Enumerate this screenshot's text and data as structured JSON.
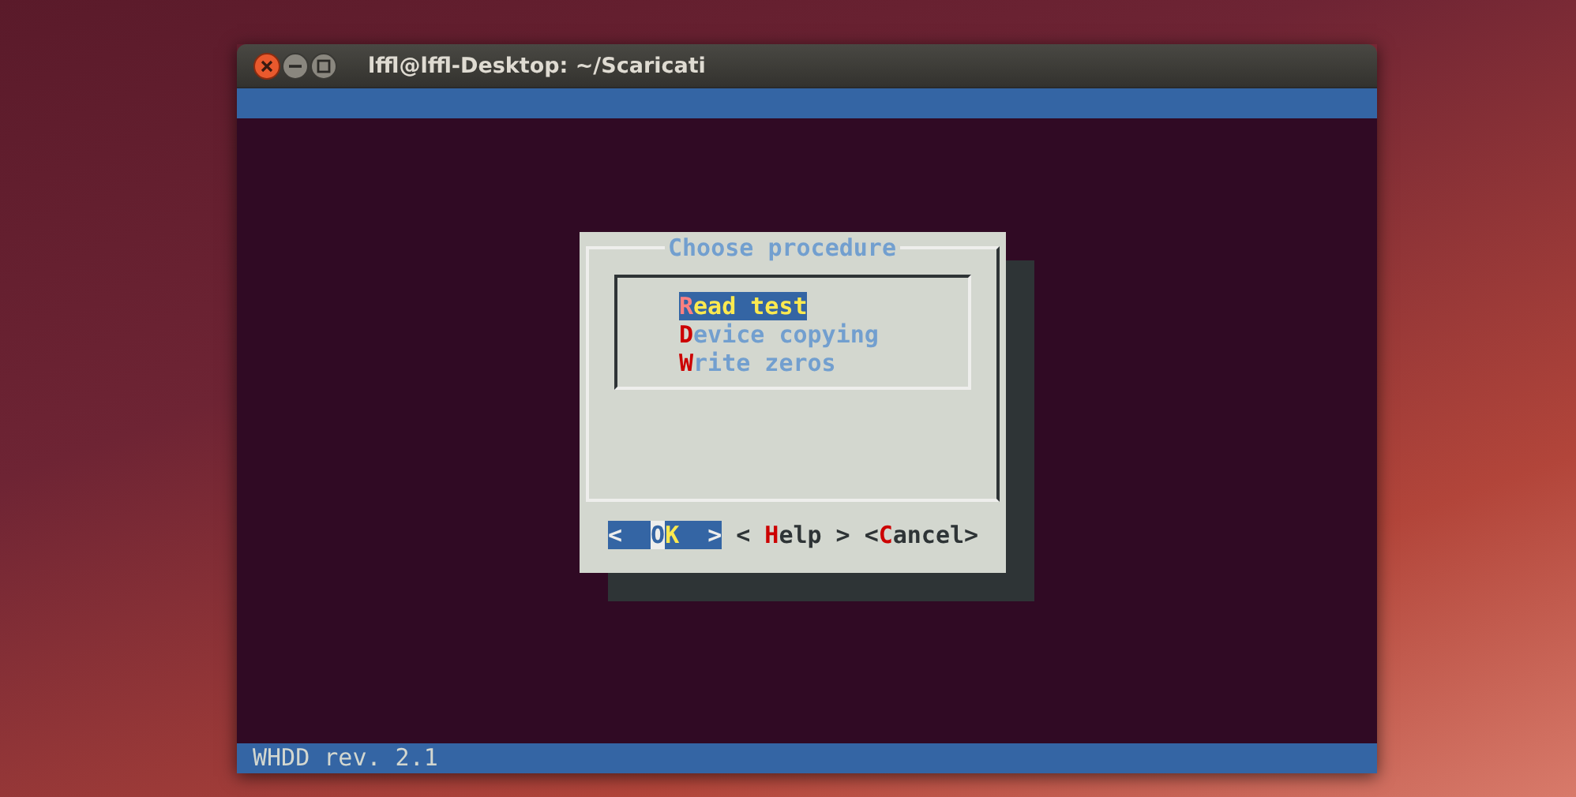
{
  "window": {
    "title": "lffl@lffl-Desktop: ~/Scaricati"
  },
  "dialog": {
    "title": "Choose procedure",
    "items": [
      {
        "hotkey": "R",
        "rest": "ead test",
        "selected": true
      },
      {
        "hotkey": "D",
        "rest": "evice copying",
        "selected": false
      },
      {
        "hotkey": "W",
        "rest": "rite zeros",
        "selected": false
      }
    ],
    "buttons": [
      {
        "open": "<",
        "hotkey": "O",
        "rest": "K",
        "close": ">",
        "selected": true
      },
      {
        "open": "<",
        "hotkey": "H",
        "rest": "elp",
        "close": ">",
        "selected": false
      },
      {
        "open": "<",
        "hotkey": "C",
        "rest": "ancel",
        "close": ">",
        "selected": false
      }
    ]
  },
  "status_bar": {
    "text": "WHDD rev. 2.1"
  }
}
